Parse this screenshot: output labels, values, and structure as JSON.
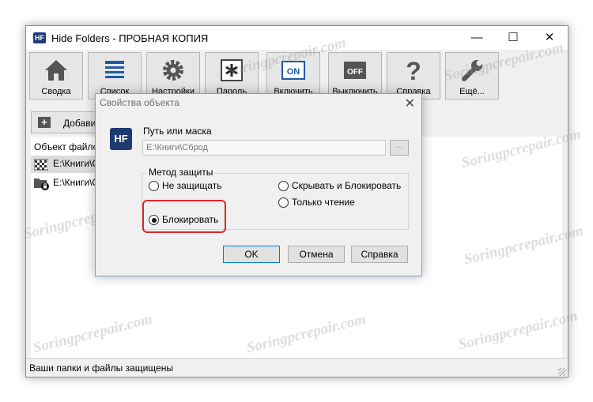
{
  "window": {
    "title": "Hide Folders - ПРОБНАЯ КОПИЯ",
    "app_icon": "HF",
    "min_glyph": "—",
    "max_glyph": "☐",
    "close_glyph": "✕"
  },
  "toolbar": {
    "summary": "Сводка",
    "list": "Список",
    "settings": "Настройки",
    "password": "Пароль",
    "enable": "Включить",
    "disable": "Выключить",
    "help": "Справка",
    "more": "Ещё..."
  },
  "icons": {
    "on_text": "ON",
    "off_text": "OFF",
    "help_glyph": "?"
  },
  "subtoolbar": {
    "add": "Добавит"
  },
  "list": {
    "header": "Объект файлов",
    "rows": [
      {
        "path": "E:\\Книги\\С"
      },
      {
        "path": "E:\\Книги\\С"
      }
    ]
  },
  "status": "Ваши папки и файлы защищены",
  "watermark": "Soringpcrepair.com",
  "dialog": {
    "title": "Свойства объекта",
    "logo": "HF",
    "path_label": "Путь или маска",
    "path_value": "E:\\Книги\\Сброд",
    "browse": "...",
    "group_label": "Метод защиты",
    "options": {
      "none": "Не защищать",
      "hide": "Скрывать",
      "lock": "Блокировать",
      "hide_lock": "Скрывать и Блокировать",
      "readonly": "Только чтение"
    },
    "selected": "lock",
    "ok": "OK",
    "cancel": "Отмена",
    "help": "Справка",
    "close_glyph": "✕"
  },
  "colors": {
    "highlight": "#d72828",
    "brand": "#1e3a73"
  }
}
